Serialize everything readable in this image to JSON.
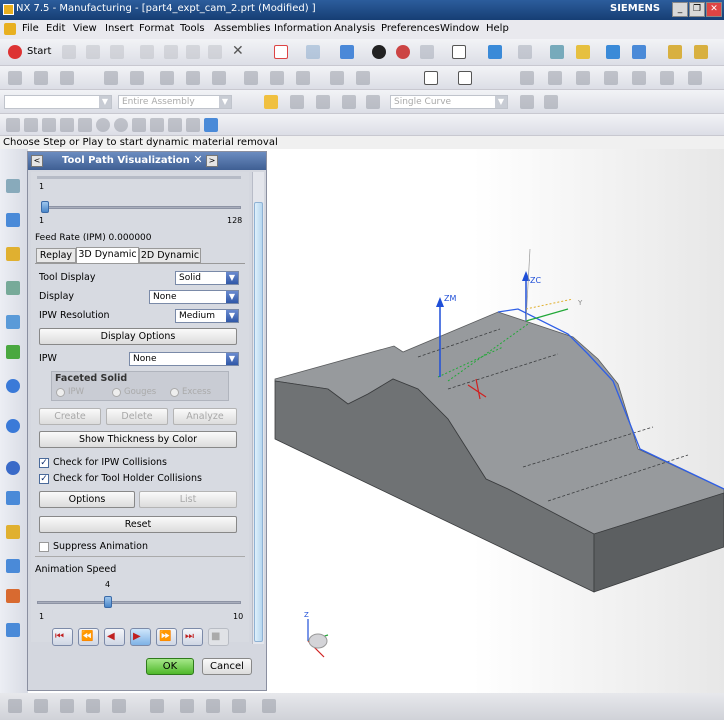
{
  "window": {
    "title": "NX 7.5 - Manufacturing - [part4_expt_cam_2.prt (Modified) ]",
    "brand": "SIEMENS",
    "buttons": [
      "_",
      "❐",
      "✕"
    ]
  },
  "menubar": {
    "items": [
      "File",
      "Edit",
      "View",
      "Insert",
      "Format",
      "Tools",
      "Assemblies",
      "Information",
      "Analysis",
      "Preferences",
      "Window",
      "Help"
    ]
  },
  "toolbar": {
    "start_label": "Start",
    "filter_value": "",
    "assembly_filter": "Entire Assembly",
    "curve_filter": "Single Curve"
  },
  "status": {
    "message": "Choose Step or Play to start dynamic material removal"
  },
  "dialog": {
    "title": "Tool Path Visualization",
    "top_slider": {
      "value": "1",
      "min": "1",
      "max": "128",
      "fraction": 0.0
    },
    "feed_rate": "Feed Rate (IPM) 0.000000",
    "tabs": [
      "Replay",
      "3D Dynamic",
      "2D Dynamic"
    ],
    "active_tab": "3D Dynamic",
    "tool_display": {
      "label": "Tool Display",
      "value": "Solid"
    },
    "display": {
      "label": "Display",
      "value": "None"
    },
    "ipw_resolution": {
      "label": "IPW Resolution",
      "value": "Medium"
    },
    "display_options_button": "Display Options",
    "ipw": {
      "label": "IPW",
      "value": "None"
    },
    "faceted_solid": {
      "title": "Faceted Solid",
      "options": [
        "IPW",
        "Gouges",
        "Excess"
      ]
    },
    "buttons_row1": [
      "Create",
      "Delete",
      "Analyze"
    ],
    "show_thickness_button": "Show Thickness by Color",
    "check_ipw": {
      "label": "Check for IPW Collisions",
      "checked": true
    },
    "check_holder": {
      "label": "Check for Tool Holder Collisions",
      "checked": true
    },
    "options_button": "Options",
    "list_button": "List",
    "reset_button": "Reset",
    "suppress_animation": {
      "label": "Suppress Animation",
      "checked": false
    },
    "animation_speed": {
      "label": "Animation Speed",
      "value": "4",
      "min": "1",
      "max": "10",
      "fraction": 0.333
    },
    "ok": "OK",
    "cancel": "Cancel"
  },
  "viewport": {
    "axis_zm": "ZM",
    "axis_zc": "ZC",
    "axis_y": "Y",
    "triad_z": "Z",
    "colors": {
      "part_side": "#7c7e80",
      "part_top": "#9a9c9e",
      "edge_highlight": "#2f5fe6",
      "tool_axis": "#1f4fd8"
    }
  }
}
